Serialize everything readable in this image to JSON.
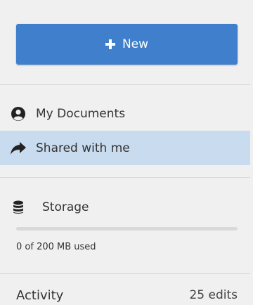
{
  "new_button": {
    "label": "New",
    "icon": "plus-icon"
  },
  "nav": {
    "items": [
      {
        "label": "My Documents",
        "icon": "user-circle-icon",
        "active": false
      },
      {
        "label": "Shared with me",
        "icon": "share-arrow-icon",
        "active": true
      }
    ]
  },
  "storage": {
    "label": "Storage",
    "icon": "database-icon",
    "usage_text": "0 of 200 MB used",
    "used_fraction": 0
  },
  "activity": {
    "label": "Activity",
    "count_text": "25 edits"
  },
  "colors": {
    "accent": "#3f7fcb",
    "active_bg": "#c9dbee",
    "panel_bg": "#f0f0f0"
  }
}
